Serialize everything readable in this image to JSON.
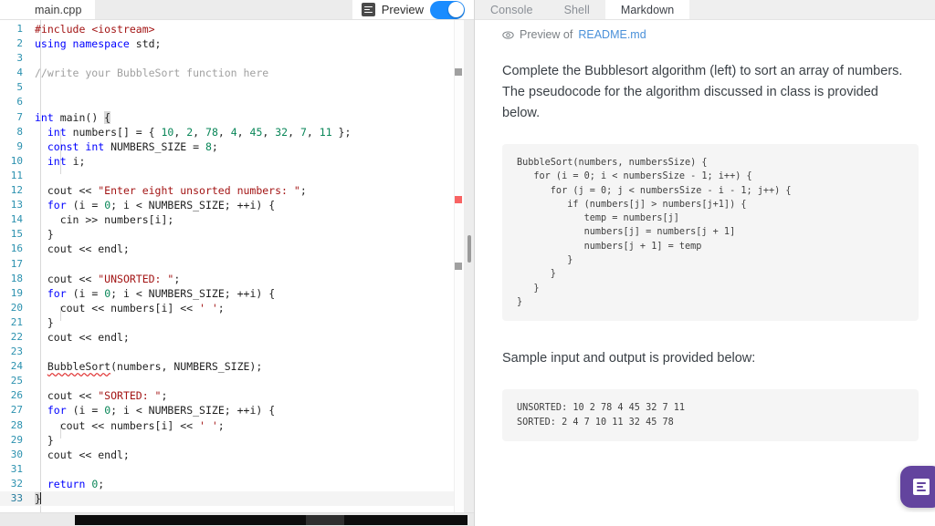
{
  "editor": {
    "tab_label": "main.cpp",
    "format_icon": "format-lines-icon",
    "preview_label": "Preview",
    "preview_toggle_state": "on",
    "accent_toggle_color": "#1a8cff",
    "lines": [
      {
        "n": "1",
        "text": "#include <iostream>"
      },
      {
        "n": "2",
        "text": "using namespace std;"
      },
      {
        "n": "3",
        "text": ""
      },
      {
        "n": "4",
        "text": "//write your BubbleSort function here"
      },
      {
        "n": "5",
        "text": ""
      },
      {
        "n": "6",
        "text": ""
      },
      {
        "n": "7",
        "text": "int main() {"
      },
      {
        "n": "8",
        "text": "  int numbers[] = { 10, 2, 78, 4, 45, 32, 7, 11 };"
      },
      {
        "n": "9",
        "text": "  const int NUMBERS_SIZE = 8;"
      },
      {
        "n": "10",
        "text": "  int i;"
      },
      {
        "n": "11",
        "text": ""
      },
      {
        "n": "12",
        "text": "  cout << \"Enter eight unsorted numbers: \";"
      },
      {
        "n": "13",
        "text": "  for (i = 0; i < NUMBERS_SIZE; ++i) {"
      },
      {
        "n": "14",
        "text": "    cin >> numbers[i];"
      },
      {
        "n": "15",
        "text": "  }"
      },
      {
        "n": "16",
        "text": "  cout << endl;"
      },
      {
        "n": "17",
        "text": ""
      },
      {
        "n": "18",
        "text": "  cout << \"UNSORTED: \";"
      },
      {
        "n": "19",
        "text": "  for (i = 0; i < NUMBERS_SIZE; ++i) {"
      },
      {
        "n": "20",
        "text": "    cout << numbers[i] << ' ';"
      },
      {
        "n": "21",
        "text": "  }"
      },
      {
        "n": "22",
        "text": "  cout << endl;"
      },
      {
        "n": "23",
        "text": ""
      },
      {
        "n": "24",
        "text": "  BubbleSort(numbers, NUMBERS_SIZE);"
      },
      {
        "n": "25",
        "text": ""
      },
      {
        "n": "26",
        "text": "  cout << \"SORTED: \";"
      },
      {
        "n": "27",
        "text": "  for (i = 0; i < NUMBERS_SIZE; ++i) {"
      },
      {
        "n": "28",
        "text": "    cout << numbers[i] << ' ';"
      },
      {
        "n": "29",
        "text": "  }"
      },
      {
        "n": "30",
        "text": "  cout << endl;"
      },
      {
        "n": "31",
        "text": ""
      },
      {
        "n": "32",
        "text": "  return 0;"
      },
      {
        "n": "33",
        "text": "}"
      }
    ],
    "error_marker_line": "13",
    "syntax_colors": {
      "keyword": "#0000ff",
      "string": "#a31515",
      "number": "#098658",
      "comment": "#a0a0a0",
      "linenumber": "#2b91af",
      "error_squiggle": "#e03131"
    }
  },
  "panel": {
    "tabs": [
      {
        "label": "Console",
        "active": false
      },
      {
        "label": "Shell",
        "active": false
      },
      {
        "label": "Markdown",
        "active": true
      }
    ],
    "preview_prefix": "Preview of",
    "preview_file": "README.md",
    "eye_icon": "eye-icon",
    "paragraph_1": "Complete the Bubblesort algorithm (left) to sort an array of numbers. The pseudocode for the algorithm discussed in class is provided below.",
    "pseudocode": "BubbleSort(numbers, numbersSize) {\n   for (i = 0; i < numbersSize - 1; i++) {\n      for (j = 0; j < numbersSize - i - 1; j++) {\n         if (numbers[j] > numbers[j+1]) {\n            temp = numbers[j]\n            numbers[j] = numbers[j + 1]\n            numbers[j + 1] = temp\n         }\n      }\n   }\n}",
    "paragraph_2": "Sample input and output is provided below:",
    "sample_output": "UNSORTED: 10 2 78 4 45 32 7 11\nSORTED: 2 4 7 10 11 32 45 78",
    "link_color": "#4a90d9"
  },
  "fab": {
    "icon": "feedback-panel-icon",
    "color": "#63449e"
  }
}
